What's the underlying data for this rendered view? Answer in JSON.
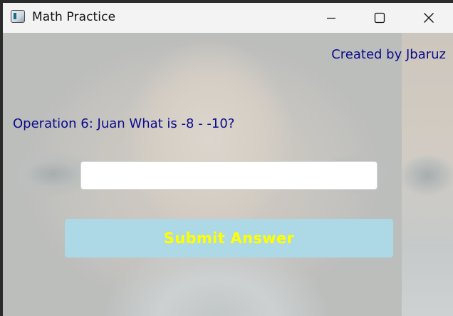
{
  "window": {
    "title": "Math Practice",
    "icon": "app-window-icon",
    "controls": {
      "minimize": "minimize-icon",
      "maximize": "maximize-icon",
      "close": "close-icon"
    }
  },
  "header": {
    "credit": "Created by Jbaruz"
  },
  "quiz": {
    "question": "Operation 6: Juan What is -8 - -10?",
    "answer_value": "",
    "submit_label": "Submit Answer"
  },
  "colors": {
    "text_primary": "#0b0b8a",
    "button_background": "#add8e6",
    "button_text": "#ffff00"
  }
}
